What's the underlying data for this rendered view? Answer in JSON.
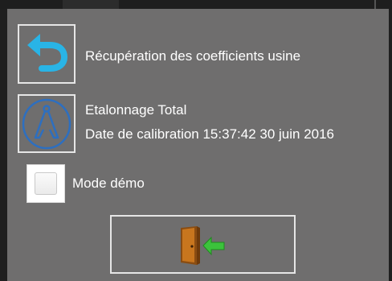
{
  "actions": {
    "restore_factory_label": "Récupération des coefficients usine",
    "calibration_title": "Etalonnage Total",
    "calibration_date_label": "Date de calibration 15:37:42 30 juin 2016"
  },
  "demo_mode": {
    "label": "Mode démo",
    "checked": false
  },
  "icons": {
    "restore": "undo-arrow-icon",
    "calibration": "caliper-icon",
    "exit": "exit-door-icon"
  },
  "colors": {
    "panel_background": "#6f6e6e",
    "text": "#ffffff",
    "restore_arrow": "#29b4e6",
    "calibration_icon": "#2d6fc0",
    "exit_door": "#c8761e",
    "exit_arrow": "#3cc23c"
  }
}
